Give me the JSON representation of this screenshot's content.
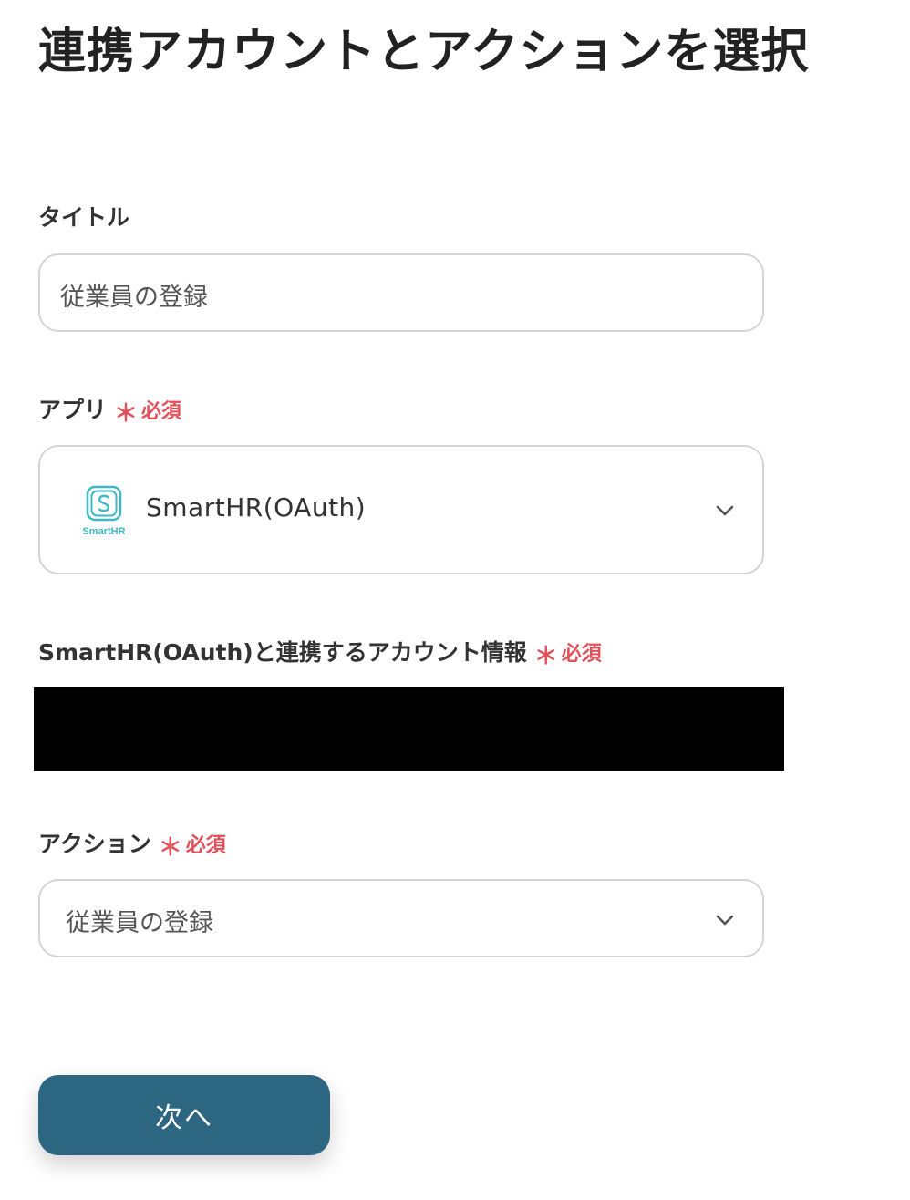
{
  "page": {
    "title": "連携アカウントとアクションを選択"
  },
  "colors": {
    "required": "#e2505a",
    "primary_button": "#2d6680",
    "border": "#d5d5d5",
    "logo_teal": "#3fb8c6"
  },
  "fields": {
    "title": {
      "label": "タイトル",
      "value": "従業員の登録"
    },
    "app": {
      "label": "アプリ",
      "required_mark": "＊",
      "required_text": "必須",
      "logo_icon": "smarthr-logo-icon",
      "logo_text": "SmartHR",
      "selected": "SmartHR(OAuth)"
    },
    "account": {
      "label": "SmartHR(OAuth)と連携するアカウント情報",
      "required_mark": "＊",
      "required_text": "必須"
    },
    "action": {
      "label": "アクション",
      "required_mark": "＊",
      "required_text": "必須",
      "selected": "従業員の登録"
    }
  },
  "buttons": {
    "next_label": "次へ"
  }
}
